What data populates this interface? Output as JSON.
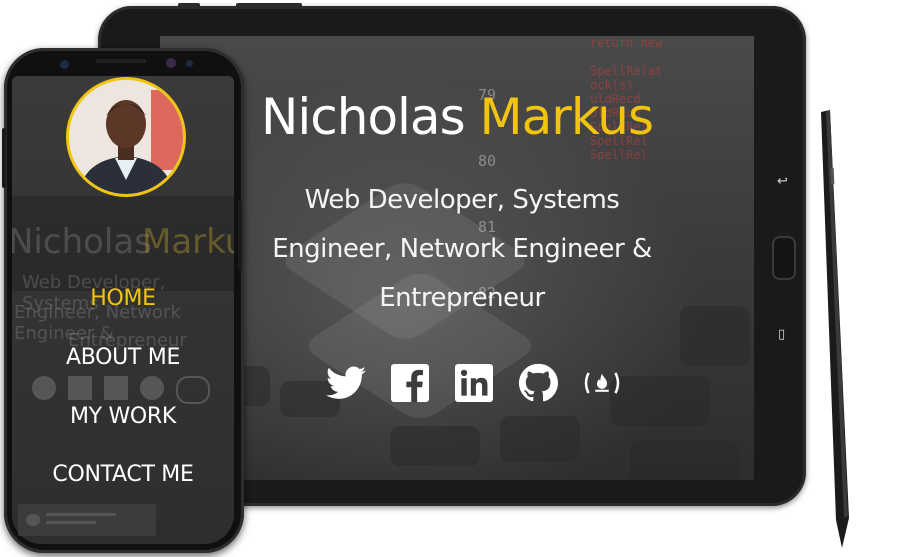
{
  "hero": {
    "first_name": "Nicholas",
    "last_name": "Markus",
    "tagline_line1": "Web Developer, Systems",
    "tagline_line2": "Engineer, Network Engineer &",
    "tagline_line3": "Entrepreneur"
  },
  "social": [
    {
      "icon": "twitter-icon"
    },
    {
      "icon": "facebook-icon"
    },
    {
      "icon": "linkedin-icon"
    },
    {
      "icon": "github-icon"
    },
    {
      "icon": "freecodecamp-icon"
    }
  ],
  "mobile_nav": {
    "items": [
      "HOME",
      "ABOUT ME",
      "MY WORK",
      "CONTACT ME"
    ],
    "active": "HOME"
  },
  "background_code": {
    "numbers": [
      "79",
      "80",
      "81",
      "82"
    ],
    "right_snippet": "return new\n\nSpellRelat\nock(s)\nuldRecd\nuldRecd\nSpellRel\nSpellRel\nSpellRel"
  },
  "colors": {
    "accent": "#f1c40f",
    "text": "#ffffff",
    "device": "#1a1a1a"
  }
}
